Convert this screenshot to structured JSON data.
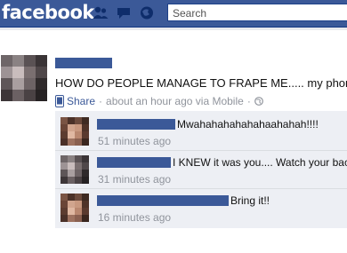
{
  "app": {
    "logo_text": "facebook"
  },
  "header": {
    "search_placeholder": "Search"
  },
  "icons": [
    "friends-icon",
    "messages-icon",
    "notifications-icon",
    "share-icon",
    "globe-icon"
  ],
  "colors": {
    "brand": "#3b5998",
    "meta_gray": "#90949c",
    "comment_bg": "#edeff4"
  },
  "post": {
    "text": "HOW DO PEOPLE MANAGE TO FRAPE ME..... my phone",
    "share_label": "Share",
    "separator": "·",
    "time_text": "about an hour ago via Mobile",
    "separator_2": "·"
  },
  "comments": [
    {
      "text": "Mwahahahahahahaahahah!!!!",
      "time": "51 minutes ago"
    },
    {
      "text": "I KNEW it was you.... Watch your back",
      "time": "31 minutes ago"
    },
    {
      "text": "Bring it!!",
      "time": "16 minutes ago"
    }
  ]
}
